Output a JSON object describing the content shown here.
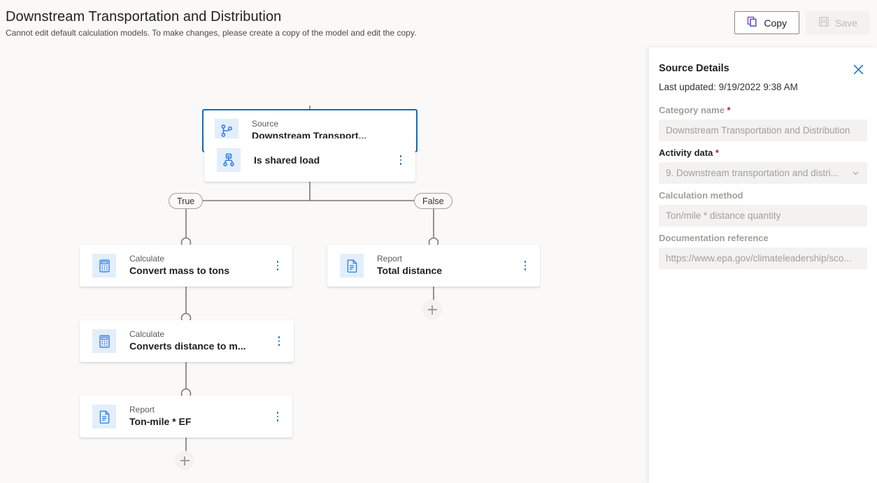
{
  "header": {
    "title": "Downstream Transportation and Distribution",
    "subtitle": "Cannot edit default calculation models. To make changes, please create a copy of the model and edit the copy.",
    "actions": [
      {
        "label": "Copy",
        "icon": "copy-icon",
        "disabled": false
      },
      {
        "label": "Save",
        "icon": "save-icon",
        "disabled": true
      }
    ]
  },
  "canvas": {
    "nodes": [
      {
        "id": "source",
        "type": "Source",
        "title": "Downstream Transport...",
        "icon": "branch-icon",
        "selected": true,
        "kebab": false
      },
      {
        "id": "condition",
        "type": "",
        "title": "Is shared load",
        "icon": "decision-icon",
        "selected": false,
        "kebab": true
      },
      {
        "id": "convert-mass",
        "type": "Calculate",
        "title": "Convert mass to tons",
        "icon": "calculator-icon",
        "selected": false,
        "kebab": true
      },
      {
        "id": "total-distance",
        "type": "Report",
        "title": "Total distance",
        "icon": "document-icon",
        "selected": false,
        "kebab": true
      },
      {
        "id": "convert-distance",
        "type": "Calculate",
        "title": "Converts distance to m...",
        "icon": "calculator-icon",
        "selected": false,
        "kebab": true
      },
      {
        "id": "ton-mile",
        "type": "Report",
        "title": "Ton-mile * EF",
        "icon": "document-icon",
        "selected": false,
        "kebab": true
      }
    ],
    "branch_labels": {
      "true": "True",
      "false": "False"
    },
    "add_buttons": [
      {
        "id": "add-false-branch",
        "label": "+"
      },
      {
        "id": "add-true-branch",
        "label": "+"
      }
    ]
  },
  "panel": {
    "title": "Source Details",
    "close_icon": "close-icon",
    "last_updated": "Last updated: 9/19/2022 9:38 AM",
    "fields": [
      {
        "label": "Category name",
        "required": true,
        "label_style": "muted",
        "value": "Downstream Transportation and Distribution",
        "control": "text"
      },
      {
        "label": "Activity data",
        "required": true,
        "label_style": "dark",
        "value": "9. Downstream transportation and distri...",
        "control": "select"
      },
      {
        "label": "Calculation method",
        "required": false,
        "label_style": "muted",
        "value": "Ton/mile * distance quantity",
        "control": "text"
      },
      {
        "label": "Documentation reference",
        "required": false,
        "label_style": "muted",
        "value": "https://www.epa.gov/climateleadership/sco...",
        "control": "text"
      }
    ]
  },
  "colors": {
    "accent_blue": "#0f6cbd",
    "icon_tile_bg": "#e3eefb",
    "canvas_bg": "#faf9f8",
    "required_red": "#a4262c",
    "edge_gray": "#7a7977"
  }
}
